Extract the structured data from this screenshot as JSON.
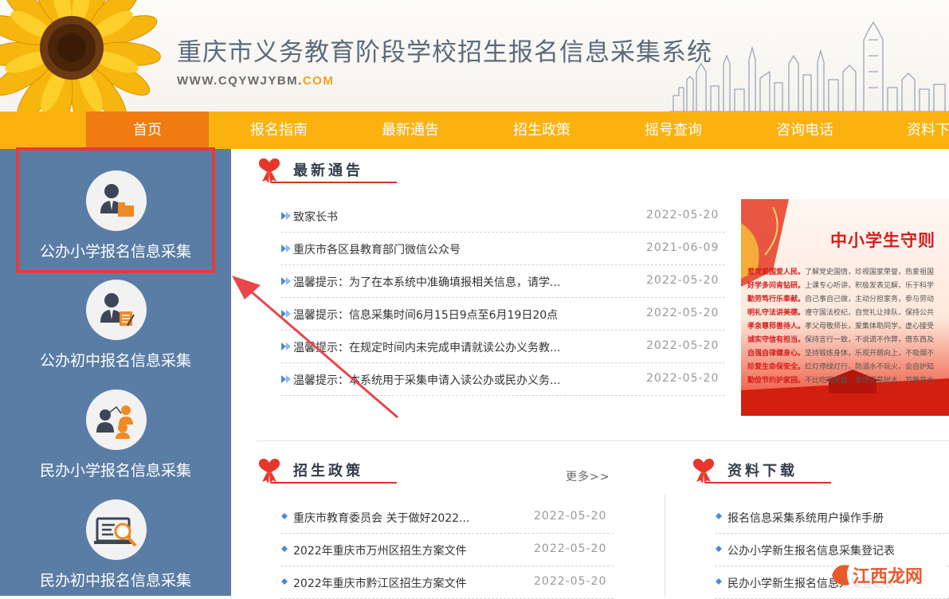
{
  "header": {
    "title": "重庆市义务教育阶段学校招生报名信息采集系统",
    "url_main": "WWW.CQYWJYBM.",
    "url_domain": "COM"
  },
  "nav": {
    "items": [
      "首页",
      "报名指南",
      "最新通告",
      "招生政策",
      "摇号查询",
      "咨询电话",
      "资料下载"
    ],
    "active_index": 0
  },
  "sidebar": {
    "items": [
      {
        "label": "公办小学报名信息采集",
        "icon": "user-folder-icon",
        "highlighted": true
      },
      {
        "label": "公办初中报名信息采集",
        "icon": "user-document-icon",
        "highlighted": false
      },
      {
        "label": "民办小学报名信息采集",
        "icon": "user-group-icon",
        "highlighted": false
      },
      {
        "label": "民办初中报名信息采集",
        "icon": "search-document-icon",
        "highlighted": false
      }
    ]
  },
  "news": {
    "title": "最新通告",
    "items": [
      {
        "title": "致家长书",
        "date": "2022-05-20"
      },
      {
        "title": "重庆市各区县教育部门微信公众号",
        "date": "2021-06-09"
      },
      {
        "title": "温馨提示：为了在本系统中准确填报相关信息，请学...",
        "date": "2022-05-20"
      },
      {
        "title": "温馨提示：信息采集时间6月15日9点至6月19日20点",
        "date": "2022-05-20"
      },
      {
        "title": "温馨提示：在规定时间内未完成申请就读公办义务教...",
        "date": "2022-05-20"
      },
      {
        "title": "温馨提示：本系统用于采集申请入读公办或民办义务...",
        "date": "2022-05-20"
      }
    ]
  },
  "banner": {
    "title": "中小学生守则",
    "lines": [
      {
        "head": "爱党爱国爱人民。",
        "body": "了解党史国情，珍视国家荣誉，热爱祖国"
      },
      {
        "head": "好学多问肯钻研。",
        "body": "上课专心听讲，积极发表见解，乐于科学"
      },
      {
        "head": "勤劳笃行乐奉献。",
        "body": "自己事自己做，主动分担家务，参与劳动"
      },
      {
        "head": "明礼守法讲美德。",
        "body": "遵守国法校纪，自觉礼让排队，保持公共"
      },
      {
        "head": "孝亲尊师善待人。",
        "body": "孝父母敬师长，爱集体助同学，虚心接受"
      },
      {
        "head": "诚实守信有担当。",
        "body": "保持言行一致，不说谎不作弊，借东西及"
      },
      {
        "head": "自强自律健身心。",
        "body": "坚持锻炼身体，乐观开朗向上，不吸烟不"
      },
      {
        "head": "珍爱生命保安全。",
        "body": "红灯停绿灯行，防溺水不玩火，会自护知"
      },
      {
        "head": "勤俭节约护家园。",
        "body": "不比吃喝穿戴，爱惜花草树木，节粮节水"
      }
    ]
  },
  "policy": {
    "title": "招生政策",
    "more": "更多>>",
    "items": [
      {
        "title": "重庆市教育委员会 关于做好2022...",
        "date": "2022-05-20"
      },
      {
        "title": "2022年重庆市万州区招生方案文件",
        "date": "2022-05-20"
      },
      {
        "title": "2022年重庆市黔江区招生方案文件",
        "date": "2022-05-20"
      }
    ]
  },
  "downloads": {
    "title": "资料下载",
    "items": [
      {
        "title": "报名信息采集系统用户操作手册"
      },
      {
        "title": "公办小学新生报名信息采集登记表"
      },
      {
        "title": "民办小学新生报名信息采集登记表"
      }
    ]
  },
  "watermark": {
    "text": "江西龙网"
  },
  "colors": {
    "nav_bg": "#fbb20f",
    "nav_active": "#f07b10",
    "sidebar_bg": "#5a7da6",
    "accent_red": "#d93025",
    "highlight_red": "#e83a3a"
  }
}
